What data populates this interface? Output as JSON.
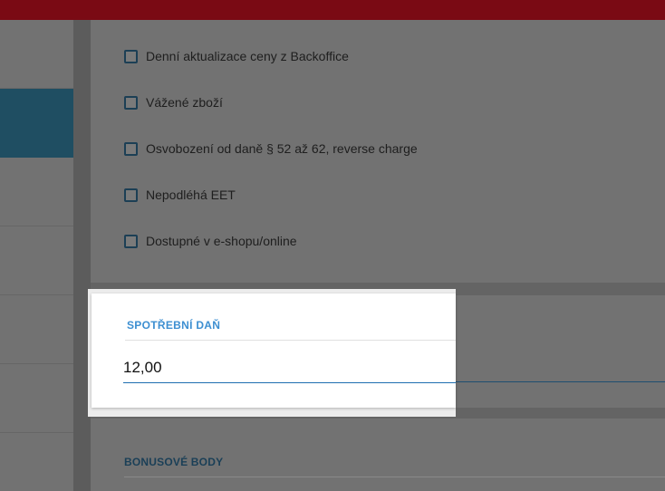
{
  "options": {
    "checkboxes": [
      {
        "label": "Denní aktualizace ceny z Backoffice",
        "checked": false
      },
      {
        "label": "Vážené zboží",
        "checked": false
      },
      {
        "label": "Osvobození od daně § 52 až 62, reverse charge",
        "checked": false
      },
      {
        "label": "Nepodléhá EET",
        "checked": false
      },
      {
        "label": "Dostupné v e-shopu/online",
        "checked": false
      }
    ]
  },
  "excise": {
    "title": "SPOTŘEBNÍ DAŇ",
    "value": "12,00"
  },
  "bonus": {
    "title": "BONUSOVÉ BODY"
  },
  "colors": {
    "topbar": "#7a0a14",
    "active_sidebar": "#1f4e62",
    "section_title_accent": "#3d8fd1",
    "input_underline": "#1f6fb0"
  }
}
